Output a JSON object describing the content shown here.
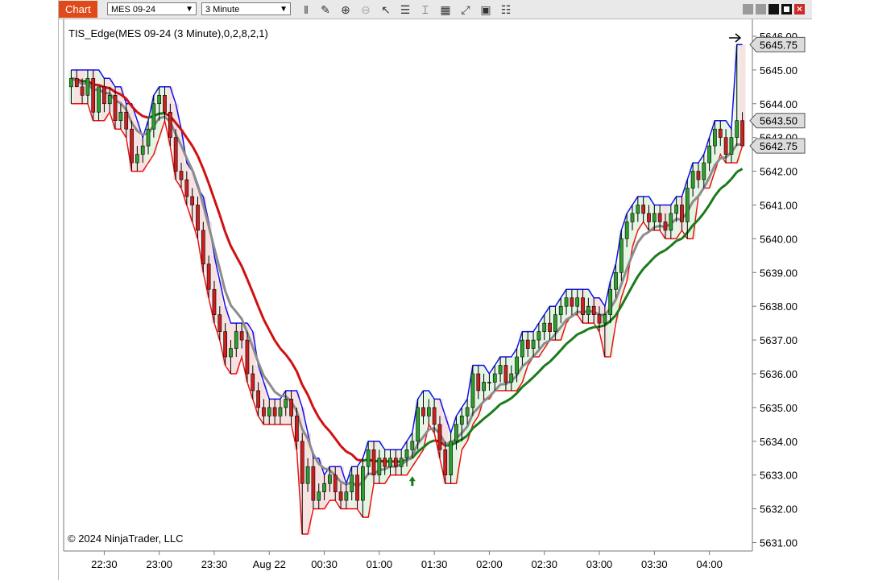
{
  "toolbar": {
    "tab_label": "Chart",
    "instrument": "MES 09-24",
    "interval": "3 Minute"
  },
  "indicator_title": "TIS_Edge(MES 09-24 (3 Minute),0,2,8,2,1)",
  "copyright": "© 2024 NinjaTrader, LLC",
  "chart_data": {
    "type": "candlestick",
    "ylim": [
      5630.75,
      5646.5
    ],
    "y_ticks": [
      "5631.00",
      "5632.00",
      "5633.00",
      "5634.00",
      "5635.00",
      "5636.00",
      "5637.00",
      "5638.00",
      "5639.00",
      "5640.00",
      "5641.00",
      "5642.00",
      "5643.00",
      "5644.00",
      "5645.00",
      "5646.00"
    ],
    "x_ticks": [
      "22:30",
      "23:00",
      "23:30",
      "Aug 22",
      "00:30",
      "01:00",
      "01:30",
      "02:00",
      "02:30",
      "03:00",
      "03:30",
      "04:00"
    ],
    "price_markers": [
      "5645.75",
      "5643.50",
      "5642.75"
    ],
    "ohlc": [
      [
        5644.5,
        5645.0,
        5644.0,
        5644.75
      ],
      [
        5644.75,
        5645.0,
        5644.5,
        5644.5
      ],
      [
        5644.5,
        5644.75,
        5644.0,
        5644.25
      ],
      [
        5644.25,
        5645.0,
        5644.0,
        5644.75
      ],
      [
        5644.75,
        5645.0,
        5643.5,
        5643.75
      ],
      [
        5643.75,
        5644.5,
        5643.5,
        5644.5
      ],
      [
        5644.5,
        5644.75,
        5643.75,
        5644.0
      ],
      [
        5644.0,
        5644.5,
        5643.75,
        5644.25
      ],
      [
        5644.25,
        5644.5,
        5643.25,
        5643.5
      ],
      [
        5643.5,
        5644.0,
        5643.25,
        5643.75
      ],
      [
        5643.75,
        5644.0,
        5643.0,
        5643.25
      ],
      [
        5643.25,
        5643.5,
        5642.0,
        5642.25
      ],
      [
        5642.25,
        5642.75,
        5642.0,
        5642.5
      ],
      [
        5642.5,
        5643.0,
        5642.25,
        5642.75
      ],
      [
        5642.75,
        5643.5,
        5642.5,
        5643.25
      ],
      [
        5643.25,
        5644.25,
        5643.0,
        5644.0
      ],
      [
        5644.0,
        5644.5,
        5643.5,
        5644.25
      ],
      [
        5644.25,
        5644.5,
        5643.5,
        5643.75
      ],
      [
        5643.75,
        5644.0,
        5642.75,
        5643.0
      ],
      [
        5643.0,
        5643.25,
        5641.75,
        5642.0
      ],
      [
        5642.0,
        5642.25,
        5641.5,
        5641.75
      ],
      [
        5641.75,
        5642.0,
        5641.0,
        5641.25
      ],
      [
        5641.25,
        5641.5,
        5640.5,
        5641.0
      ],
      [
        5641.0,
        5641.25,
        5640.0,
        5640.25
      ],
      [
        5640.25,
        5640.5,
        5639.0,
        5639.25
      ],
      [
        5639.25,
        5639.5,
        5638.25,
        5638.5
      ],
      [
        5638.5,
        5638.75,
        5637.5,
        5637.75
      ],
      [
        5637.75,
        5638.0,
        5637.0,
        5637.25
      ],
      [
        5637.25,
        5637.5,
        5636.25,
        5636.5
      ],
      [
        5636.5,
        5637.0,
        5636.0,
        5636.75
      ],
      [
        5636.75,
        5637.5,
        5636.5,
        5637.25
      ],
      [
        5637.25,
        5637.5,
        5636.75,
        5637.0
      ],
      [
        5637.0,
        5637.25,
        5635.75,
        5636.0
      ],
      [
        5636.0,
        5636.25,
        5635.25,
        5635.5
      ],
      [
        5635.5,
        5635.75,
        5634.75,
        5635.0
      ],
      [
        5635.0,
        5635.25,
        5634.5,
        5634.75
      ],
      [
        5634.75,
        5635.25,
        5634.5,
        5635.0
      ],
      [
        5635.0,
        5635.25,
        5634.5,
        5634.75
      ],
      [
        5634.75,
        5635.25,
        5634.5,
        5635.0
      ],
      [
        5635.0,
        5635.5,
        5634.75,
        5635.25
      ],
      [
        5635.25,
        5635.5,
        5634.5,
        5634.75
      ],
      [
        5634.75,
        5635.0,
        5633.75,
        5634.0
      ],
      [
        5634.0,
        5634.25,
        5631.25,
        5632.75
      ],
      [
        5632.75,
        5633.5,
        5632.5,
        5633.25
      ],
      [
        5633.25,
        5633.5,
        5632.0,
        5632.25
      ],
      [
        5632.25,
        5632.75,
        5632.0,
        5632.5
      ],
      [
        5632.5,
        5633.0,
        5632.25,
        5632.75
      ],
      [
        5632.75,
        5633.25,
        5632.5,
        5633.0
      ],
      [
        5633.0,
        5633.25,
        5632.25,
        5632.5
      ],
      [
        5632.5,
        5632.75,
        5632.0,
        5632.25
      ],
      [
        5632.25,
        5632.75,
        5632.0,
        5632.5
      ],
      [
        5632.5,
        5633.25,
        5632.25,
        5633.0
      ],
      [
        5633.0,
        5633.25,
        5632.0,
        5632.25
      ],
      [
        5632.25,
        5633.5,
        5631.75,
        5633.25
      ],
      [
        5633.25,
        5634.0,
        5633.0,
        5633.75
      ],
      [
        5633.75,
        5634.0,
        5632.75,
        5633.0
      ],
      [
        5633.0,
        5633.75,
        5632.75,
        5633.5
      ],
      [
        5633.5,
        5633.75,
        5633.0,
        5633.25
      ],
      [
        5633.25,
        5633.75,
        5633.0,
        5633.5
      ],
      [
        5633.5,
        5633.75,
        5633.0,
        5633.25
      ],
      [
        5633.25,
        5633.75,
        5633.0,
        5633.5
      ],
      [
        5633.5,
        5634.0,
        5633.25,
        5633.75
      ],
      [
        5633.75,
        5634.25,
        5633.5,
        5634.0
      ],
      [
        5634.0,
        5635.25,
        5633.75,
        5635.0
      ],
      [
        5635.0,
        5635.5,
        5634.5,
        5634.75
      ],
      [
        5634.75,
        5635.25,
        5634.5,
        5635.0
      ],
      [
        5635.0,
        5635.25,
        5634.25,
        5634.5
      ],
      [
        5634.5,
        5634.75,
        5633.5,
        5633.75
      ],
      [
        5633.75,
        5634.0,
        5632.75,
        5633.0
      ],
      [
        5633.0,
        5634.25,
        5632.75,
        5634.0
      ],
      [
        5634.0,
        5634.75,
        5633.75,
        5634.5
      ],
      [
        5634.5,
        5635.0,
        5634.0,
        5634.75
      ],
      [
        5634.75,
        5635.25,
        5634.5,
        5635.0
      ],
      [
        5635.0,
        5636.25,
        5634.75,
        5636.0
      ],
      [
        5636.0,
        5636.25,
        5635.25,
        5635.5
      ],
      [
        5635.5,
        5636.0,
        5635.25,
        5635.75
      ],
      [
        5635.75,
        5636.0,
        5635.5,
        5635.75
      ],
      [
        5635.75,
        5636.25,
        5635.5,
        5636.0
      ],
      [
        5636.0,
        5636.5,
        5635.75,
        5636.25
      ],
      [
        5636.25,
        5636.5,
        5635.5,
        5635.75
      ],
      [
        5635.75,
        5636.25,
        5635.5,
        5636.0
      ],
      [
        5636.0,
        5636.75,
        5635.75,
        5636.5
      ],
      [
        5636.5,
        5637.25,
        5636.25,
        5637.0
      ],
      [
        5637.0,
        5637.25,
        5636.5,
        5636.75
      ],
      [
        5636.75,
        5637.25,
        5636.5,
        5637.0
      ],
      [
        5637.0,
        5637.5,
        5636.75,
        5637.25
      ],
      [
        5637.25,
        5637.75,
        5637.0,
        5637.5
      ],
      [
        5637.5,
        5638.0,
        5637.0,
        5637.25
      ],
      [
        5637.25,
        5638.0,
        5637.0,
        5637.75
      ],
      [
        5637.75,
        5638.25,
        5637.5,
        5638.0
      ],
      [
        5638.0,
        5638.5,
        5637.75,
        5638.25
      ],
      [
        5638.25,
        5638.5,
        5637.75,
        5638.0
      ],
      [
        5638.0,
        5638.5,
        5637.75,
        5638.25
      ],
      [
        5638.25,
        5638.5,
        5637.5,
        5637.75
      ],
      [
        5637.75,
        5638.25,
        5637.5,
        5638.0
      ],
      [
        5638.0,
        5638.25,
        5637.5,
        5637.75
      ],
      [
        5637.75,
        5638.0,
        5637.25,
        5637.5
      ],
      [
        5637.5,
        5638.0,
        5636.5,
        5637.75
      ],
      [
        5637.75,
        5638.75,
        5637.5,
        5638.5
      ],
      [
        5638.5,
        5639.25,
        5638.25,
        5639.0
      ],
      [
        5639.0,
        5640.25,
        5638.75,
        5640.0
      ],
      [
        5640.0,
        5640.75,
        5639.75,
        5640.5
      ],
      [
        5640.5,
        5641.0,
        5640.25,
        5640.75
      ],
      [
        5640.75,
        5641.25,
        5640.5,
        5641.0
      ],
      [
        5641.0,
        5641.25,
        5640.5,
        5640.75
      ],
      [
        5640.75,
        5641.0,
        5640.25,
        5640.5
      ],
      [
        5640.5,
        5641.0,
        5640.25,
        5640.75
      ],
      [
        5640.75,
        5641.0,
        5640.25,
        5640.5
      ],
      [
        5640.5,
        5640.75,
        5640.0,
        5640.25
      ],
      [
        5640.25,
        5641.0,
        5640.0,
        5640.75
      ],
      [
        5640.75,
        5641.25,
        5640.5,
        5641.0
      ],
      [
        5641.0,
        5641.25,
        5640.25,
        5640.5
      ],
      [
        5640.5,
        5641.75,
        5640.0,
        5641.5
      ],
      [
        5641.5,
        5642.25,
        5641.25,
        5642.0
      ],
      [
        5642.0,
        5642.25,
        5641.5,
        5641.75
      ],
      [
        5641.75,
        5642.5,
        5641.5,
        5642.25
      ],
      [
        5642.25,
        5643.0,
        5642.0,
        5642.75
      ],
      [
        5642.75,
        5643.5,
        5642.5,
        5643.25
      ],
      [
        5643.25,
        5643.5,
        5642.75,
        5643.0
      ],
      [
        5643.0,
        5643.25,
        5642.25,
        5642.5
      ],
      [
        5642.5,
        5643.25,
        5642.25,
        5643.0
      ],
      [
        5643.0,
        5645.75,
        5642.75,
        5643.5
      ],
      [
        5643.5,
        5643.75,
        5642.75,
        5642.75
      ]
    ]
  },
  "colors": {
    "up": "#2e9e2e",
    "down": "#cc1f1f",
    "upper_band": "#1010ee",
    "lower_band": "#ee1010",
    "signal_down": "#d01010",
    "signal_up": "#1a7a1a",
    "avg_line": "#8c8c8c"
  }
}
